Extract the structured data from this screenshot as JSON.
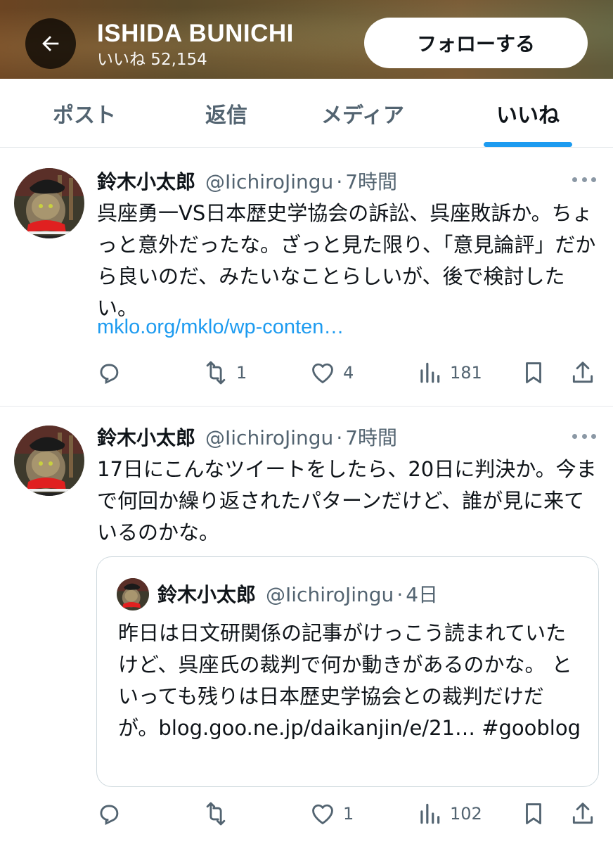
{
  "header": {
    "profile_name": "ISHIDA BUNICHI",
    "likes_label": "いいね 52,154",
    "follow_label": "フォローする"
  },
  "tabs": [
    {
      "label": "ポスト",
      "active": false
    },
    {
      "label": "返信",
      "active": false
    },
    {
      "label": "メディア",
      "active": false
    },
    {
      "label": "いいね",
      "active": true
    }
  ],
  "colors": {
    "accent": "#1d9bf0",
    "text": "#0f1419",
    "muted": "#536471"
  },
  "tweets": [
    {
      "author": "鈴木小太郎",
      "handle": "@IichiroJingu",
      "dot": "·",
      "time": "7時間",
      "text": "呉座勇一VS日本歴史学協会の訴訟、呉座敗訴か。ちょっと意外だったな。ざっと見た限り、「意見論評」だから良いのだ、みたいなことらしいが、後で検討したい。",
      "link": "mklo.org/mklo/wp-conten…",
      "replies": "",
      "reposts": "1",
      "likes": "4",
      "views": "181"
    },
    {
      "author": "鈴木小太郎",
      "handle": "@IichiroJingu",
      "dot": "·",
      "time": "7時間",
      "text": "17日にこんなツイートをしたら、20日に判決か。今まで何回か繰り返されたパターンだけど、誰が見に来ているのかな。",
      "quote": {
        "author": "鈴木小太郎",
        "handle": "@IichiroJingu",
        "dot": "·",
        "time": "4日",
        "text": "昨日は日文研関係の記事がけっこう読まれていたけど、呉座氏の裁判で何か動きがあるのかな。 といっても残りは日本歴史学協会との裁判だけだが。blog.goo.ne.jp/daikanjin/e/21… #gooblog"
      },
      "replies": "",
      "reposts": "",
      "likes": "1",
      "views": "102"
    }
  ],
  "icons": [
    "back-arrow-icon",
    "more-icon",
    "reply-icon",
    "repost-icon",
    "like-icon",
    "views-icon",
    "bookmark-icon",
    "share-icon"
  ]
}
